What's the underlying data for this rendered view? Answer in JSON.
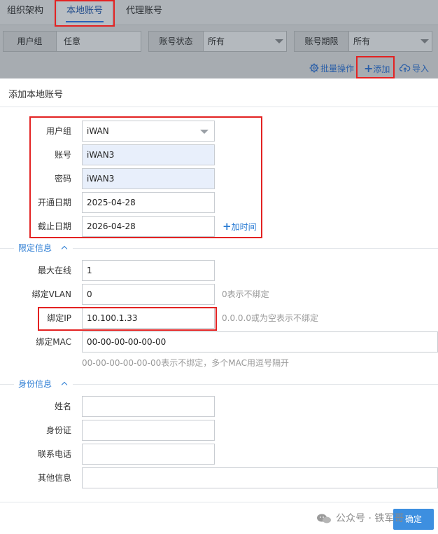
{
  "tabs": [
    {
      "label": "组织架构"
    },
    {
      "label": "本地账号",
      "active": true
    },
    {
      "label": "代理账号"
    }
  ],
  "filters": {
    "user_group": {
      "label": "用户组",
      "value": "任意"
    },
    "account_status": {
      "label": "账号状态",
      "value": "所有"
    },
    "account_expiry": {
      "label": "账号期限",
      "value": "所有"
    }
  },
  "actions": {
    "batch_label": "批量操作",
    "add_label": "添加",
    "import_label": "导入"
  },
  "dialog": {
    "title": "添加本地账号",
    "fields": {
      "user_group": {
        "label": "用户组",
        "value": "iWAN"
      },
      "account": {
        "label": "账号",
        "value": "iWAN3"
      },
      "password": {
        "label": "密码",
        "value": "iWAN3"
      },
      "start_date": {
        "label": "开通日期",
        "value": "2025-04-28"
      },
      "end_date": {
        "label": "截止日期",
        "value": "2026-04-28"
      },
      "add_time": "加时间"
    },
    "limits": {
      "title": "限定信息",
      "max_online": {
        "label": "最大在线",
        "value": "1"
      },
      "bind_vlan": {
        "label": "绑定VLAN",
        "value": "0",
        "hint": "0表示不绑定"
      },
      "bind_ip": {
        "label": "绑定IP",
        "value": "10.100.1.33",
        "hint": "0.0.0.0或为空表示不绑定"
      },
      "bind_mac": {
        "label": "绑定MAC",
        "value": "00-00-00-00-00-00",
        "hint": "00-00-00-00-00-00表示不绑定，多个MAC用逗号隔开"
      }
    },
    "identity": {
      "title": "身份信息",
      "name": {
        "label": "姓名",
        "value": ""
      },
      "id_card": {
        "label": "身份证",
        "value": ""
      },
      "phone": {
        "label": "联系电话",
        "value": ""
      },
      "other": {
        "label": "其他信息",
        "value": ""
      }
    },
    "confirm_label": "确定"
  },
  "watermark": "公众号 · 铁军哥",
  "colors": {
    "accent": "#2b7cd3",
    "highlight": "#e32222",
    "button": "#3d8fe0"
  }
}
